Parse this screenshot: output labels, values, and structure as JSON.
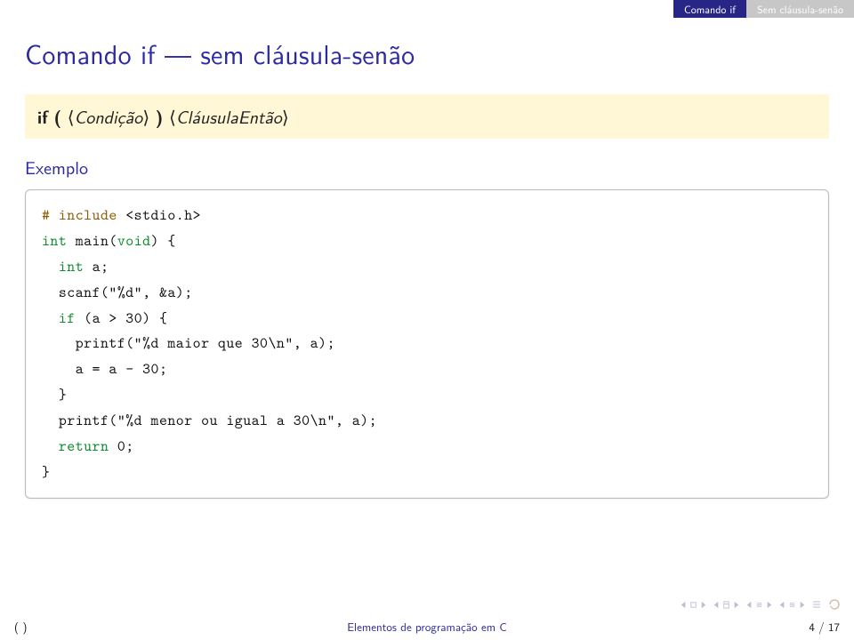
{
  "topbar": {
    "tab_active": "Comando if",
    "tab_inactive": "Sem cláusula-senão"
  },
  "title": "Comando if — sem cláusula-senão",
  "syntax": {
    "if_kw": "if",
    "lparen": "(",
    "cond_l": "⟨",
    "cond": "Condição",
    "cond_r": "⟩",
    "rparen": ")",
    "then_l": "⟨",
    "then": "CláusulaEntão",
    "then_r": "⟩"
  },
  "example_label": "Exemplo",
  "code": {
    "l1a": "# include ",
    "l1b": "<stdio.h>",
    "l2a": "int",
    "l2b": " main(",
    "l2c": "void",
    "l2d": ") {",
    "l3a": "  ",
    "l3b": "int",
    "l3c": " a;",
    "l4": "  scanf(\"%d\", &a);",
    "l5a": "  ",
    "l5b": "if",
    "l5c": " (a > 30) {",
    "l6": "    printf(\"%d maior que 30\\n\", a);",
    "l7": "    a = a - 30;",
    "l8": "  }",
    "l9": "  printf(\"%d menor ou igual a 30\\n\", a);",
    "l10a": "  ",
    "l10b": "return",
    "l10c": " 0;",
    "l11": "}"
  },
  "footer": {
    "left": "( )",
    "center": "Elementos de programação em C",
    "right": "4 / 17"
  },
  "nav": {
    "frame_prev": "frame-prev",
    "frame_next": "frame-next",
    "subsec_prev": "subsection-prev",
    "subsec_next": "subsection-next",
    "sec_prev": "section-prev",
    "sec_next": "section-next",
    "toc_prev": "toc-prev",
    "toc_next": "toc-next",
    "back": "back-icon",
    "search": "search-icon",
    "cycle": "cycle-icon"
  }
}
